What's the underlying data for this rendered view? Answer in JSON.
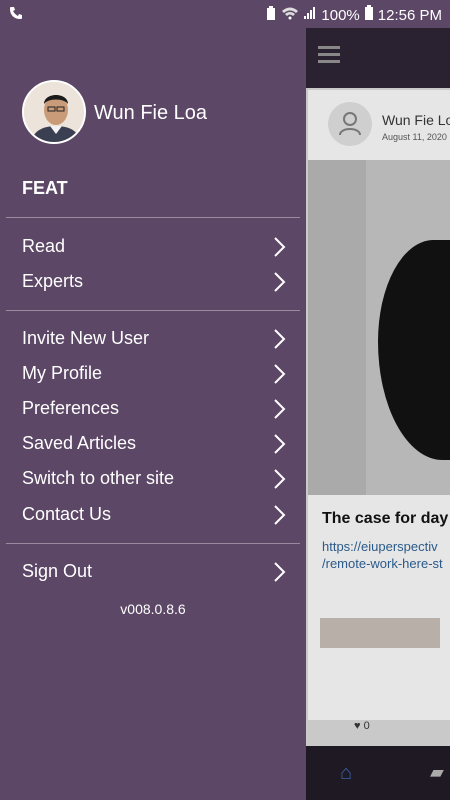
{
  "status_bar": {
    "battery": "100%",
    "time": "12:56 PM"
  },
  "drawer": {
    "user_name": "Wun Fie Loa",
    "site_name": "FEAT",
    "primary_items": [
      {
        "label": "Read"
      },
      {
        "label": "Experts"
      }
    ],
    "secondary_items": [
      {
        "label": "Invite New User"
      },
      {
        "label": "My Profile"
      },
      {
        "label": "Preferences"
      },
      {
        "label": "Saved Articles"
      },
      {
        "label": "Switch to other site"
      },
      {
        "label": "Contact Us"
      }
    ],
    "sign_out": "Sign Out",
    "version": "v008.0.8.6"
  },
  "background_app": {
    "author": "Wun Fie Lo",
    "date": "August 11, 2020",
    "title": "The case for day",
    "link_line1": "https://eiuperspectiv",
    "link_line2": "/remote-work-here-st",
    "likes": "0"
  },
  "colors": {
    "drawer_bg": "#5d4766",
    "toolbar_bg": "#2a2230"
  }
}
